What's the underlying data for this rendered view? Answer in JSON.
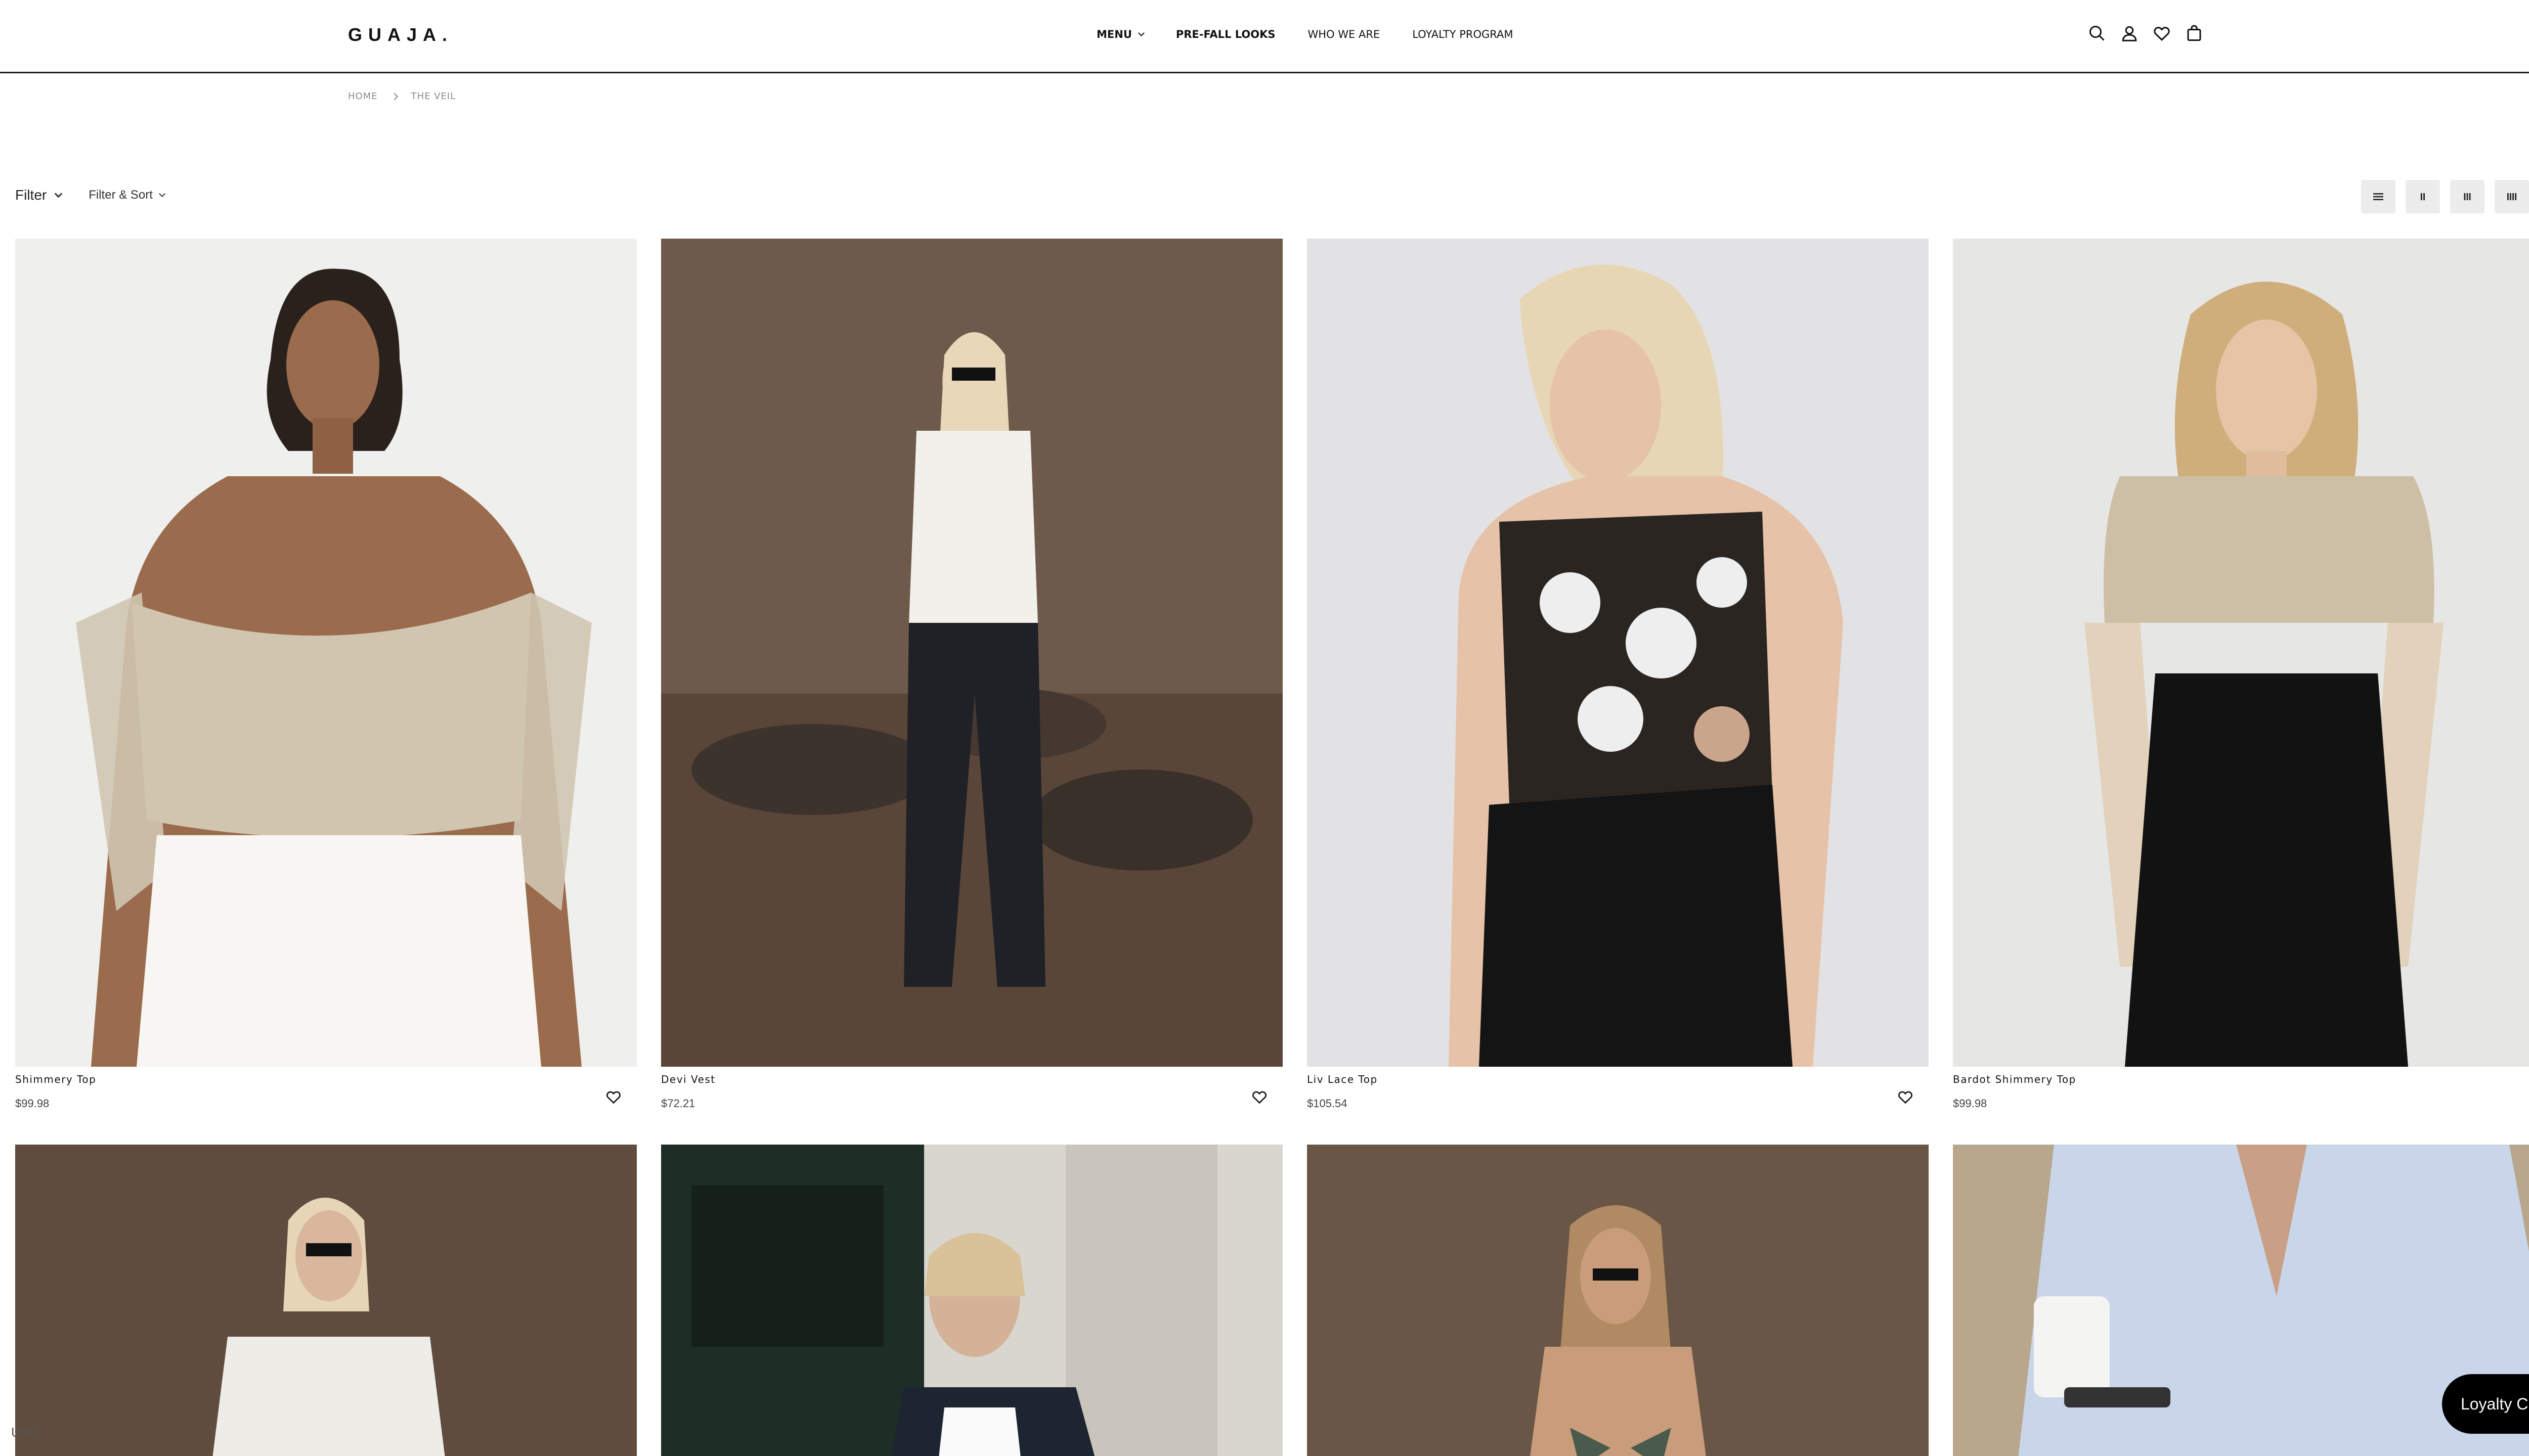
{
  "header": {
    "logo": "GUAJA.",
    "nav": [
      {
        "label": "MENU",
        "has_dropdown": true,
        "bold": true
      },
      {
        "label": "PRE-FALL LOOKS",
        "bold": true
      },
      {
        "label": "WHO WE ARE",
        "bold": false
      },
      {
        "label": "LOYALTY PROGRAM",
        "bold": false
      }
    ],
    "icons": [
      "search-icon",
      "account-icon",
      "wishlist-heart-icon",
      "cart-bag-icon"
    ],
    "close_glyph": "×"
  },
  "breadcrumb": {
    "home": "HOME",
    "current": "THE VEIL"
  },
  "toolbar": {
    "filter_label": "Filter",
    "filter_sort_label": "Filter & Sort",
    "view_options": [
      "list-view-icon",
      "grid-2-icon",
      "grid-3-icon",
      "grid-4-icon",
      "grid-5-icon"
    ]
  },
  "products": [
    {
      "name": "Shimmery Top",
      "price": "$99.98"
    },
    {
      "name": "Devi Vest",
      "price": "$72.21"
    },
    {
      "name": "Liv Lace Top",
      "price": "$105.54"
    },
    {
      "name": "Bardot Shimmery Top",
      "price": "$99.98"
    }
  ],
  "loyalty_button": "Loyalty Club",
  "currency": "USD",
  "colors": {
    "text": "#111111",
    "muted": "#8a8a8a",
    "toggle_bg": "#ececec",
    "loyalty_bg": "#000000"
  }
}
